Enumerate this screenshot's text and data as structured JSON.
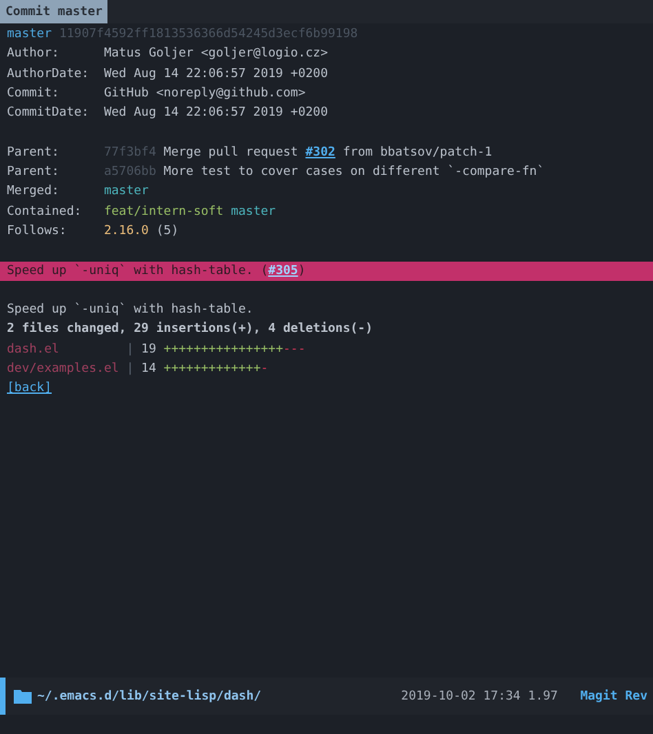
{
  "tab": {
    "label": "Commit master"
  },
  "ref_line": {
    "branch": "master",
    "hash": "11907f4592ff1813536366d54245d3ecf6b99198"
  },
  "fields": [
    {
      "label": "Author:",
      "value": "Matus Goljer <goljer@logio.cz>"
    },
    {
      "label": "AuthorDate:",
      "value": "Wed Aug 14 22:06:57 2019 +0200"
    },
    {
      "label": "Commit:",
      "value": "GitHub <noreply@github.com>"
    },
    {
      "label": "CommitDate:",
      "value": "Wed Aug 14 22:06:57 2019 +0200"
    }
  ],
  "parents": [
    {
      "label": "Parent:",
      "hash": "77f3bf4",
      "text": "Merge pull request ",
      "link": "#302",
      "text_after": " from bbatsov/patch-1"
    },
    {
      "label": "Parent:",
      "hash": "a5706bb",
      "text": "More test to cover cases on different `-compare-fn`"
    }
  ],
  "refs": [
    {
      "label": "Merged:",
      "items": [
        {
          "text": "master",
          "kind": "branch"
        }
      ]
    },
    {
      "label": "Contained:",
      "items": [
        {
          "text": "feat/intern-soft",
          "kind": "local"
        },
        {
          "text": "master",
          "kind": "branch"
        }
      ]
    },
    {
      "label": "Follows:",
      "items": [
        {
          "text": "2.16.0",
          "kind": "tag"
        },
        {
          "text": "(5)",
          "kind": "count"
        }
      ]
    }
  ],
  "summary": {
    "text": "Speed up `-uniq` with hash-table. (",
    "link": "#305",
    "text_after": ")"
  },
  "message": "Speed up `-uniq` with hash-table.",
  "stat": "2 files changed, 29 insertions(+), 4 deletions(-)",
  "files": [
    {
      "name": "dash.el",
      "separator": "|",
      "count": "19",
      "plus": "++++++++++++++++",
      "minus": "---"
    },
    {
      "name": "dev/examples.el",
      "separator": "|",
      "count": "14",
      "plus": "+++++++++++++",
      "minus": "-"
    }
  ],
  "back": "[back]",
  "mode_line": {
    "path": "~/.emacs.d/lib/site-lisp/dash/",
    "info": "2019-10-02 17:34 1.97",
    "mode": "Magit Rev"
  }
}
